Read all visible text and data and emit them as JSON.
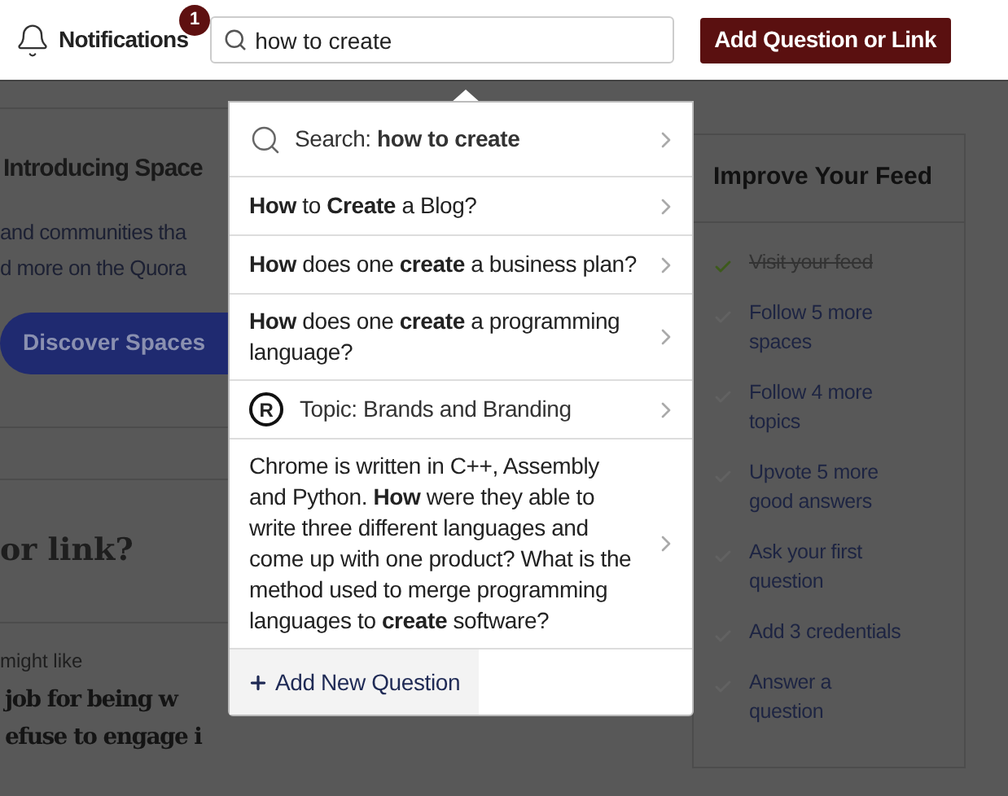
{
  "header": {
    "notifications": "Notifications",
    "badge": "1",
    "search_value": "how to create",
    "add_button": "Add Question or Link"
  },
  "spaces_card": {
    "title": "Introducing Space",
    "lines": [
      "and communities tha",
      "d more on the Quora"
    ],
    "button": "Discover Spaces"
  },
  "ask_prompt": "or link?",
  "recommended": {
    "label": "might like",
    "headline": [
      "job for being w",
      "efuse to engage i"
    ]
  },
  "suggestions": [
    {
      "kind": "search",
      "text": "Search: **how to create**"
    },
    {
      "kind": "question",
      "text": "**How** to **Create** a Blog?"
    },
    {
      "kind": "question",
      "text": "**How** does one **create** a business plan?"
    },
    {
      "kind": "question",
      "text": "**How** does one **create** a programming language?"
    },
    {
      "kind": "topic",
      "icon_letter": "R",
      "text": "Topic: Brands and Branding"
    },
    {
      "kind": "question",
      "text": "Chrome is written in C++, Assembly and Python. **How** were they able to write three different languages and come up with one product? What is the method used to merge programming languages to **create** software?"
    }
  ],
  "add_new_question": "Add New Question",
  "feed": {
    "title": "Improve Your Feed",
    "items": [
      {
        "text": "Visit your feed",
        "done": true
      },
      {
        "text": "Follow 5 more spaces",
        "done": false
      },
      {
        "text": "Follow 4 more topics",
        "done": false
      },
      {
        "text": "Upvote 5 more good answers",
        "done": false
      },
      {
        "text": "Ask your first question",
        "done": false
      },
      {
        "text": "Add 3 credentials",
        "done": false
      },
      {
        "text": "Answer a question",
        "done": false
      }
    ]
  }
}
